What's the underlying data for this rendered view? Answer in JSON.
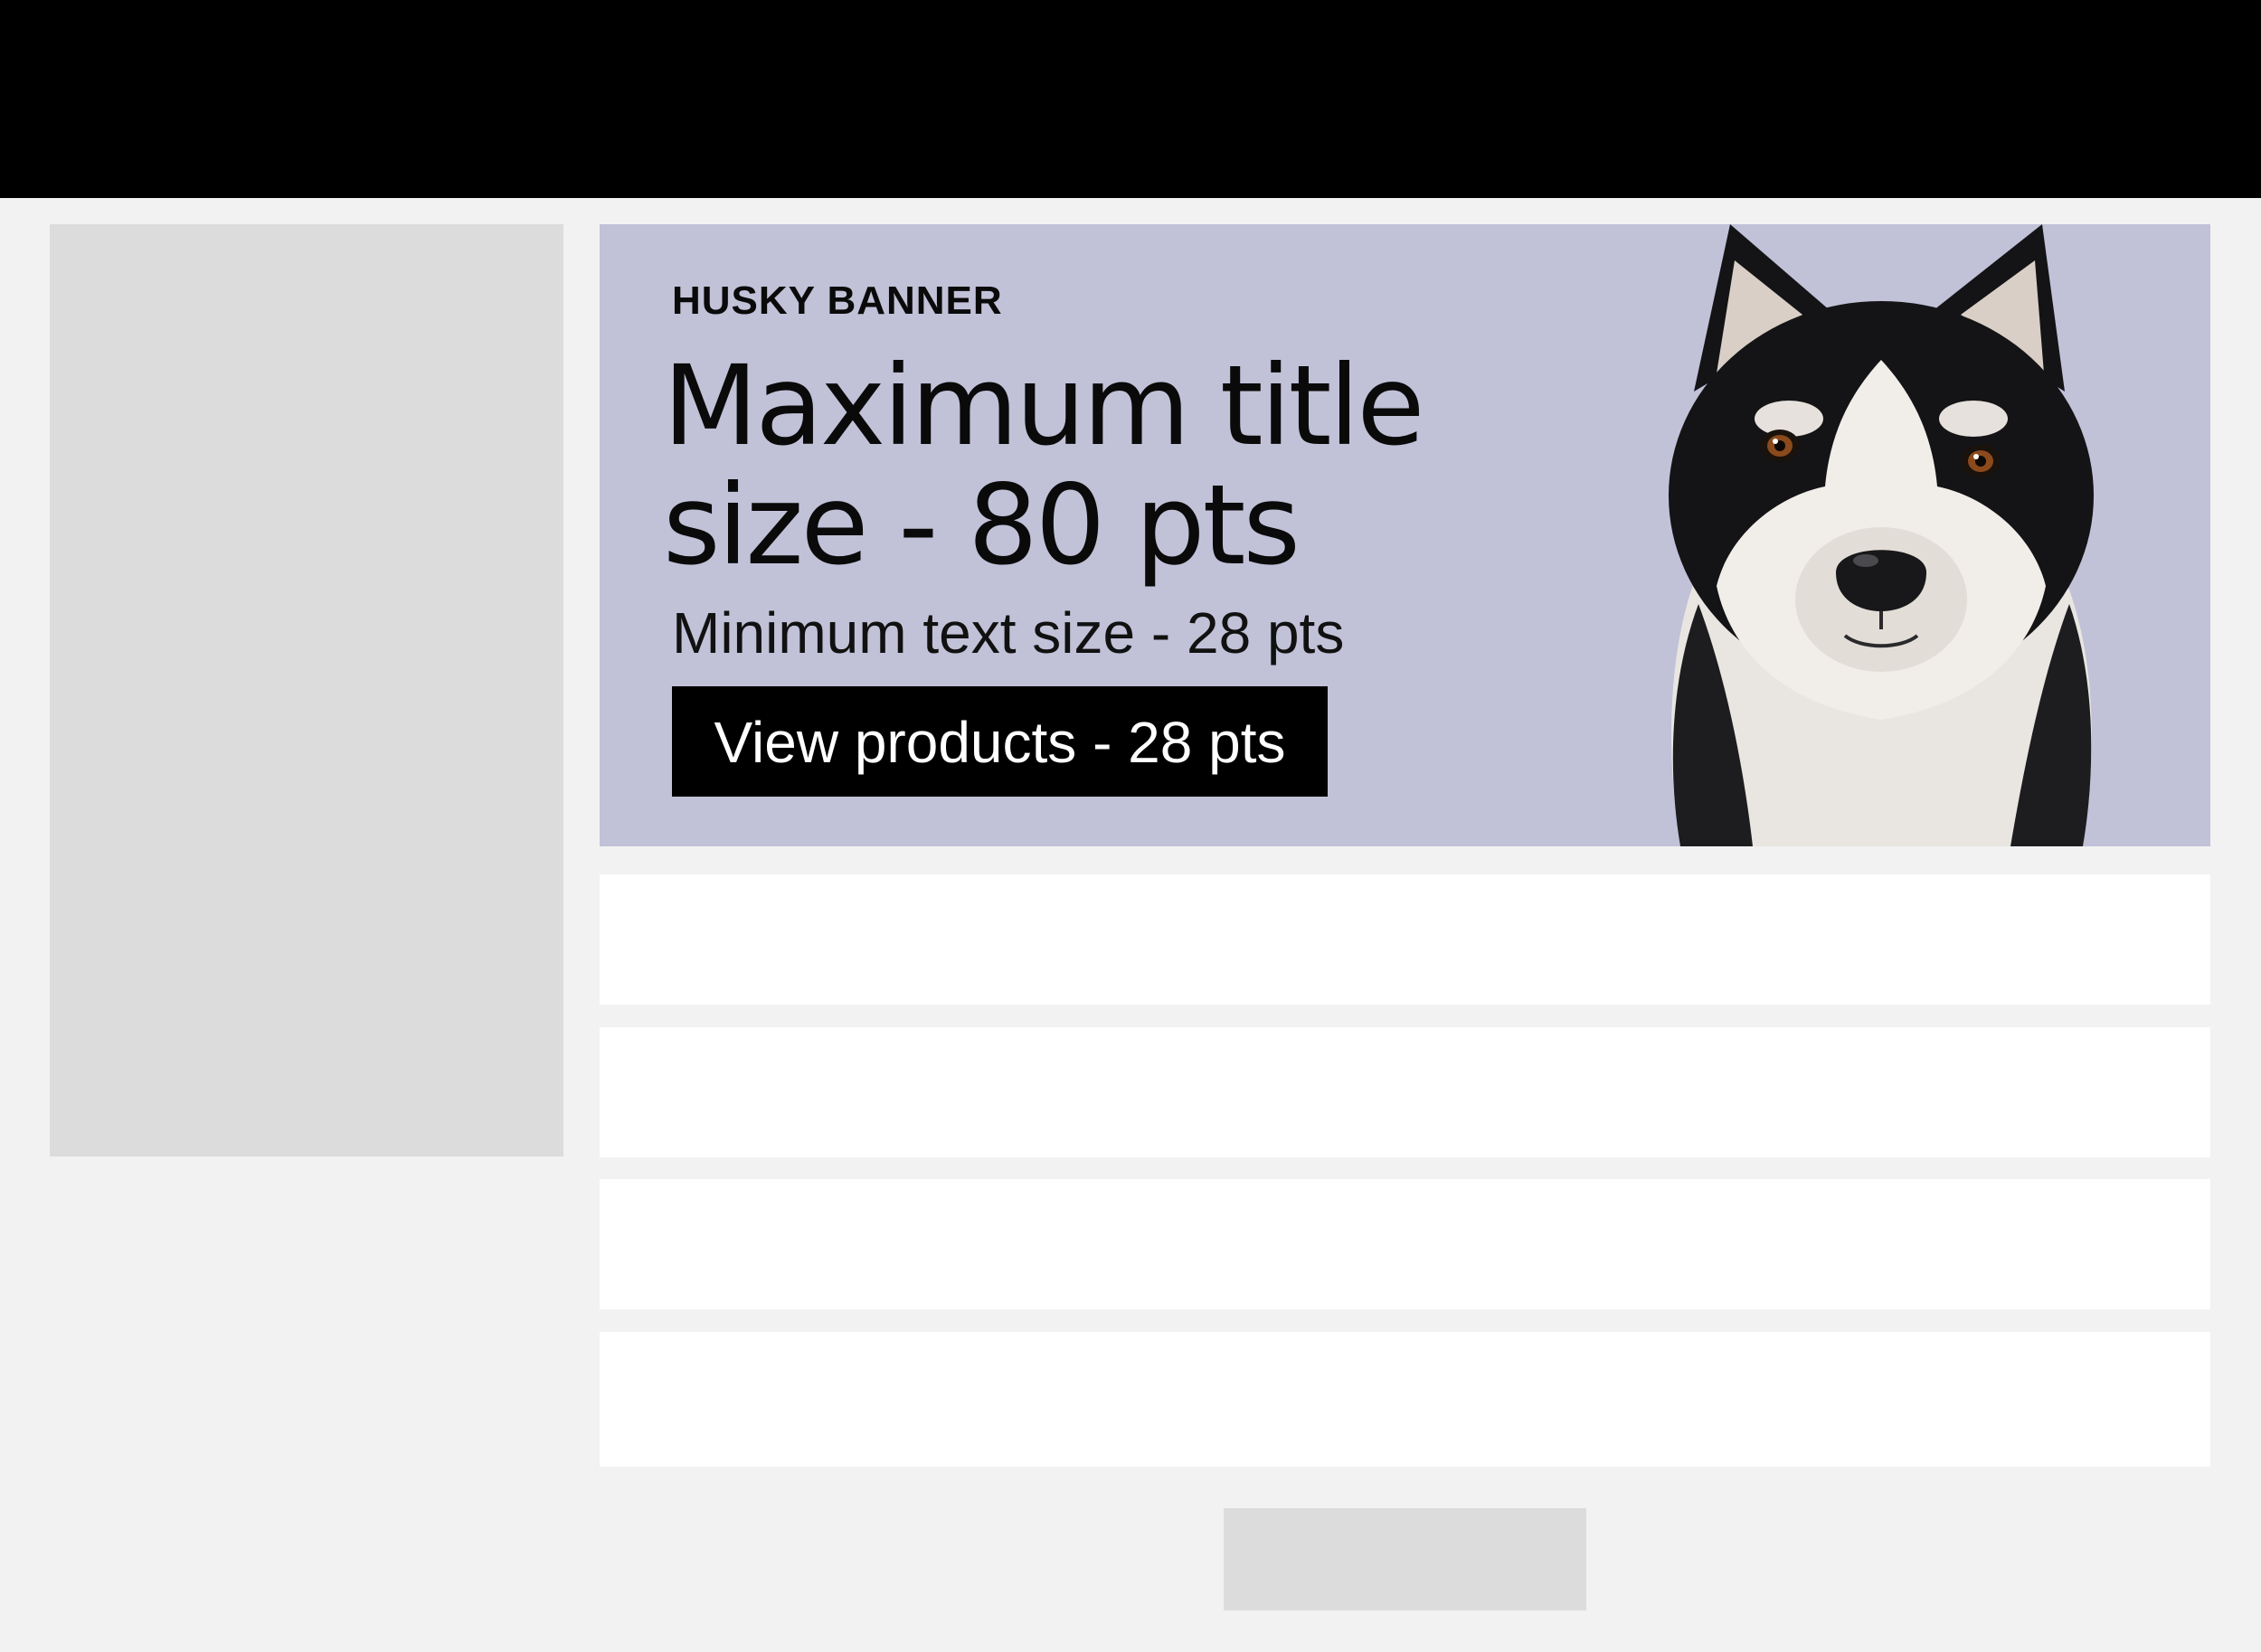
{
  "banner": {
    "eyebrow": "HUSKY BANNER",
    "title_line1": "Maximum title",
    "title_line2": "size - 80 pts",
    "subtext": "Minimum text size - 28 pts",
    "cta_label": "View products - 28 pts",
    "image": "husky-dog-portrait",
    "background_color": "#c1c1d8"
  },
  "colors": {
    "top_bar": "#000000",
    "page_background": "#f2f2f2",
    "placeholder": "#dcdcdc",
    "row": "#ffffff"
  }
}
